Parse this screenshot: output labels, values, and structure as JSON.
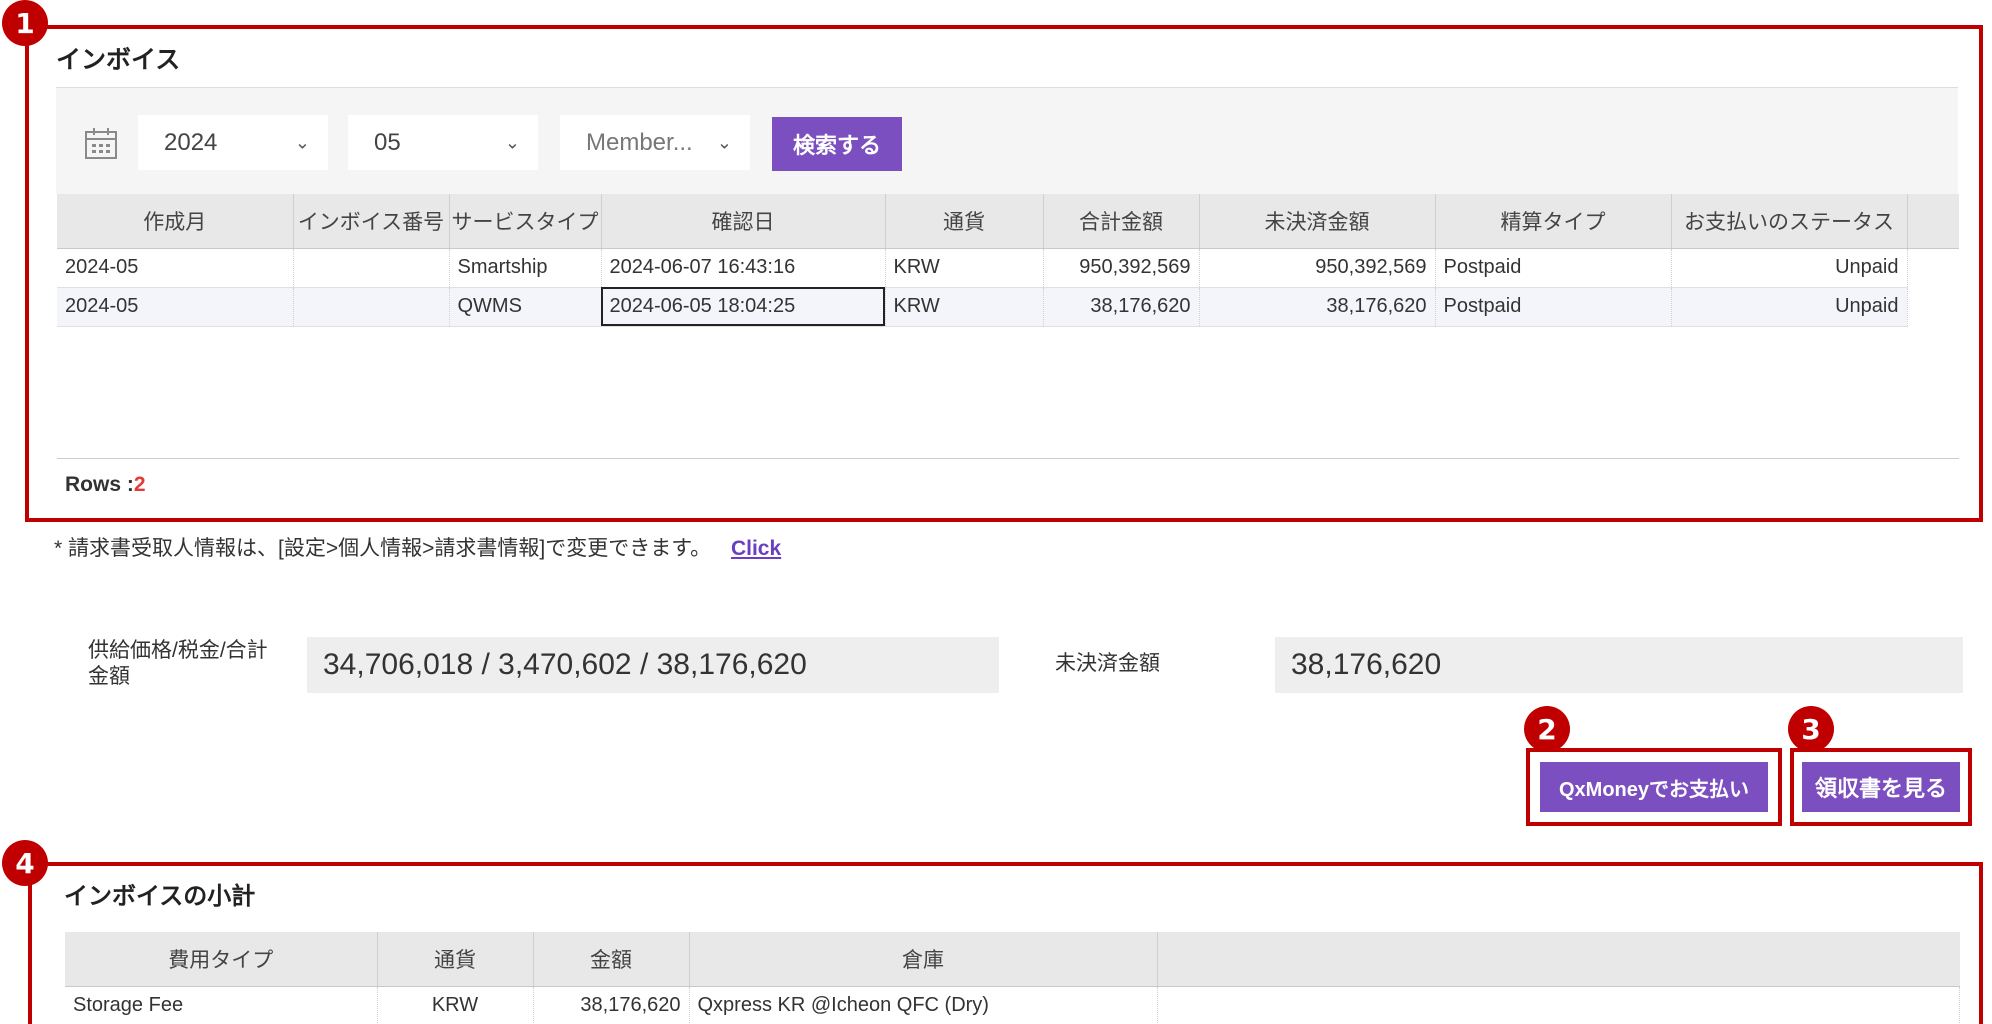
{
  "badges": [
    "1",
    "2",
    "3",
    "4"
  ],
  "invoice": {
    "title": "インボイス",
    "filters": {
      "year": "2024",
      "month": "05",
      "member": "Member...",
      "search_label": "検索する"
    },
    "columns": [
      "作成月",
      "インボイス番号",
      "サービスタイプ",
      "確認日",
      "通貨",
      "合計金額",
      "未決済金額",
      "精算タイプ",
      "お支払いのステータス"
    ],
    "rows": [
      [
        "2024-05",
        "",
        "Smartship",
        "2024-06-07 16:43:16",
        "KRW",
        "950,392,569",
        "950,392,569",
        "Postpaid",
        "Unpaid"
      ],
      [
        "2024-05",
        "",
        "QWMS",
        "2024-06-05 18:04:25",
        "KRW",
        "38,176,620",
        "38,176,620",
        "Postpaid",
        "Unpaid"
      ]
    ],
    "rows_label": "Rows : ",
    "rows_count": "2"
  },
  "note": {
    "text": "* 請求書受取人情報は、[設定>個人情報>請求書情報]で変更できます。",
    "link": "Click"
  },
  "summary": {
    "supply_label_line1": "供給価格/税金/合計",
    "supply_label_line2": "金額",
    "supply_value": "34,706,018 / 3,470,602 / 38,176,620",
    "unpaid_label": "未決済金額",
    "unpaid_value": "38,176,620"
  },
  "actions": {
    "pay_label": "QxMoneyでお支払い",
    "receipt_label": "領収書を見る"
  },
  "subtotal": {
    "title": "インボイスの小計",
    "columns": [
      "費用タイプ",
      "通貨",
      "金額",
      "倉庫",
      ""
    ],
    "rows": [
      [
        "Storage Fee",
        "KRW",
        "38,176,620",
        "Qxpress KR @Icheon QFC (Dry)",
        ""
      ]
    ]
  },
  "colors": {
    "accent": "#7b4fc0",
    "annotation": "#c00000",
    "rows_count": "#e53935",
    "link": "#6a3fc2"
  }
}
